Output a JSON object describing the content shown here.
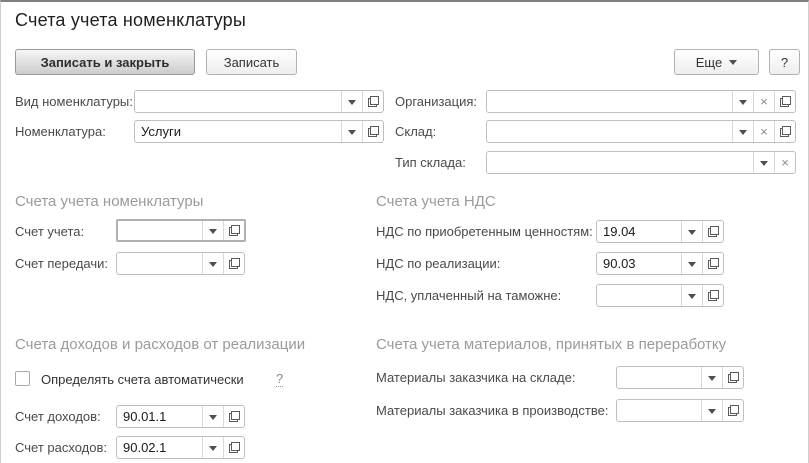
{
  "window": {
    "title": "Счета учета номенклатуры"
  },
  "toolbar": {
    "save_and_close": "Записать и закрыть",
    "save": "Записать",
    "more": "Еще",
    "help": "?"
  },
  "top_fields": {
    "vid_nomenklatury": {
      "label": "Вид номенклатуры:",
      "value": ""
    },
    "nomenklatura": {
      "label": "Номенклатура:",
      "value": "Услуги"
    },
    "organizaciya": {
      "label": "Организация:",
      "value": ""
    },
    "sklad": {
      "label": "Склад:",
      "value": ""
    },
    "tip_sklada": {
      "label": "Тип склада:",
      "value": ""
    }
  },
  "sections": {
    "nomenclature": {
      "title": "Счета учета номенклатуры",
      "schet_ucheta": {
        "label": "Счет учета:",
        "value": ""
      },
      "schet_peredachi": {
        "label": "Счет передачи:",
        "value": ""
      }
    },
    "vat": {
      "title": "Счета учета НДС",
      "nds_priobretennym": {
        "label": "НДС по приобретенным ценностям:",
        "value": "19.04"
      },
      "nds_realizacii": {
        "label": "НДС по реализации:",
        "value": "90.03"
      },
      "nds_tamozhne": {
        "label": "НДС, уплаченный на таможне:",
        "value": ""
      }
    },
    "income_expense": {
      "title": "Счета доходов и расходов от реализации",
      "auto_checkbox_label": "Определять счета автоматически",
      "auto_checkbox_checked": false,
      "help_link": "?",
      "schet_dohodov": {
        "label": "Счет доходов:",
        "value": "90.01.1"
      },
      "schet_rashodov": {
        "label": "Счет расходов:",
        "value": "90.02.1"
      }
    },
    "materials": {
      "title": "Счета учета материалов, принятых в переработку",
      "na_sklade": {
        "label": "Материалы заказчика на складе:",
        "value": ""
      },
      "v_proizvodstve": {
        "label": "Материалы заказчика в производстве:",
        "value": ""
      }
    }
  },
  "colors": {
    "window_top_border": "#7f7f7f",
    "field_border": "#bfbfbf",
    "section_title_text": "#9b9b9b",
    "default_button_gradient_bottom": "#cccccc"
  }
}
